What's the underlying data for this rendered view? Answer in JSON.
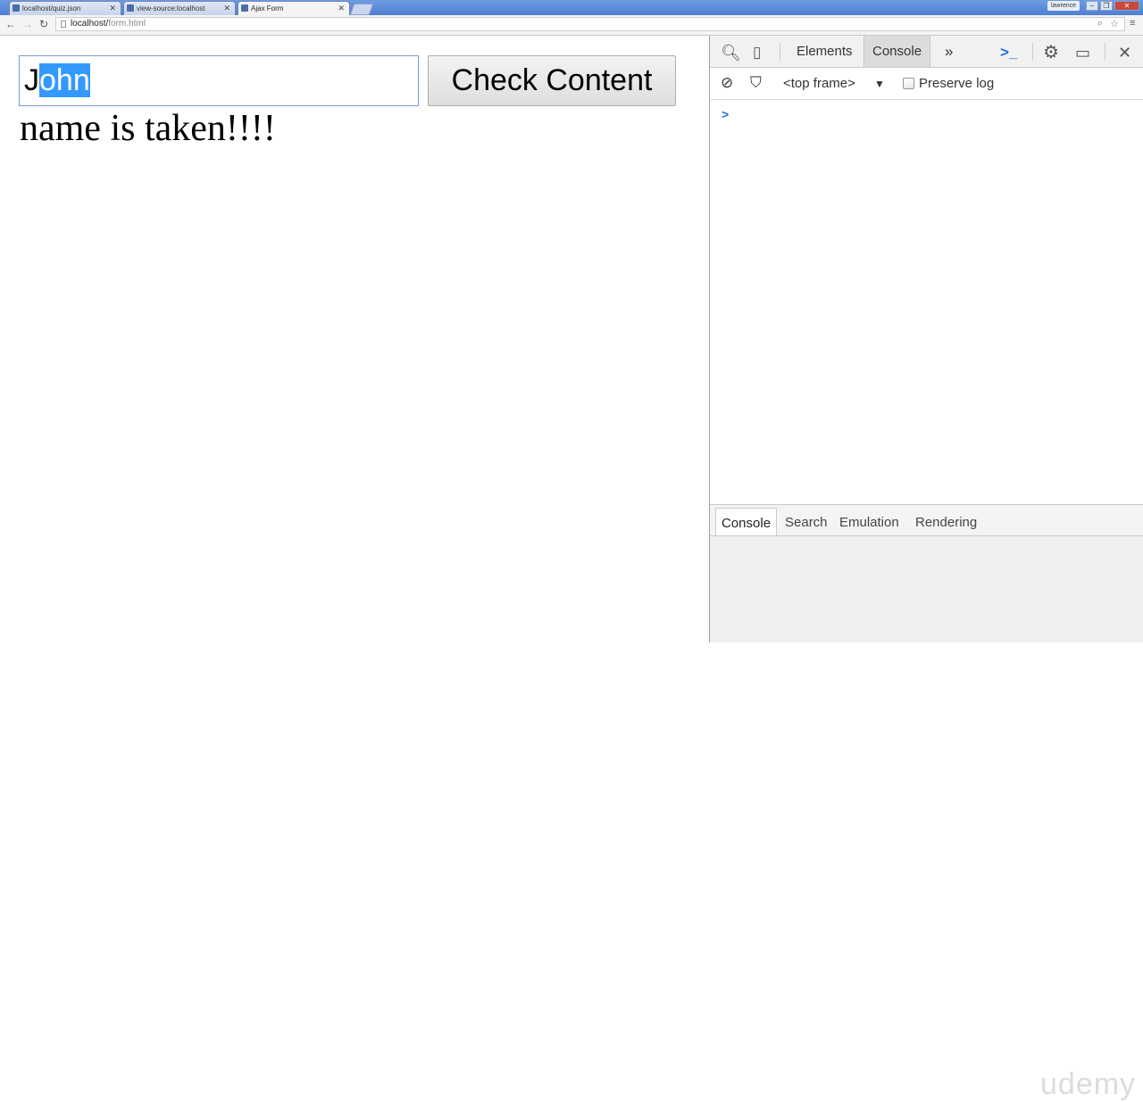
{
  "browser": {
    "tabs": [
      {
        "label": "localhost/quiz.json"
      },
      {
        "label": "view-source:localhost"
      },
      {
        "label": "Ajax Form"
      }
    ],
    "user": "lawrence",
    "url_host": "localhost/",
    "url_path": "form.html"
  },
  "page": {
    "input_value": "John",
    "input_selected_start": "J",
    "input_selected_part": "ohn",
    "button_label": "Check Content",
    "result_text": "name is taken!!!!"
  },
  "devtools": {
    "tabs": [
      "Elements",
      "Console"
    ],
    "active_tab": "Console",
    "more": "»",
    "frame": "<top frame>",
    "preserve_log": "Preserve log",
    "prompt": ">",
    "drawer_tabs": [
      "Console",
      "Search",
      "Emulation",
      "Rendering"
    ]
  },
  "watermark": "udemy"
}
